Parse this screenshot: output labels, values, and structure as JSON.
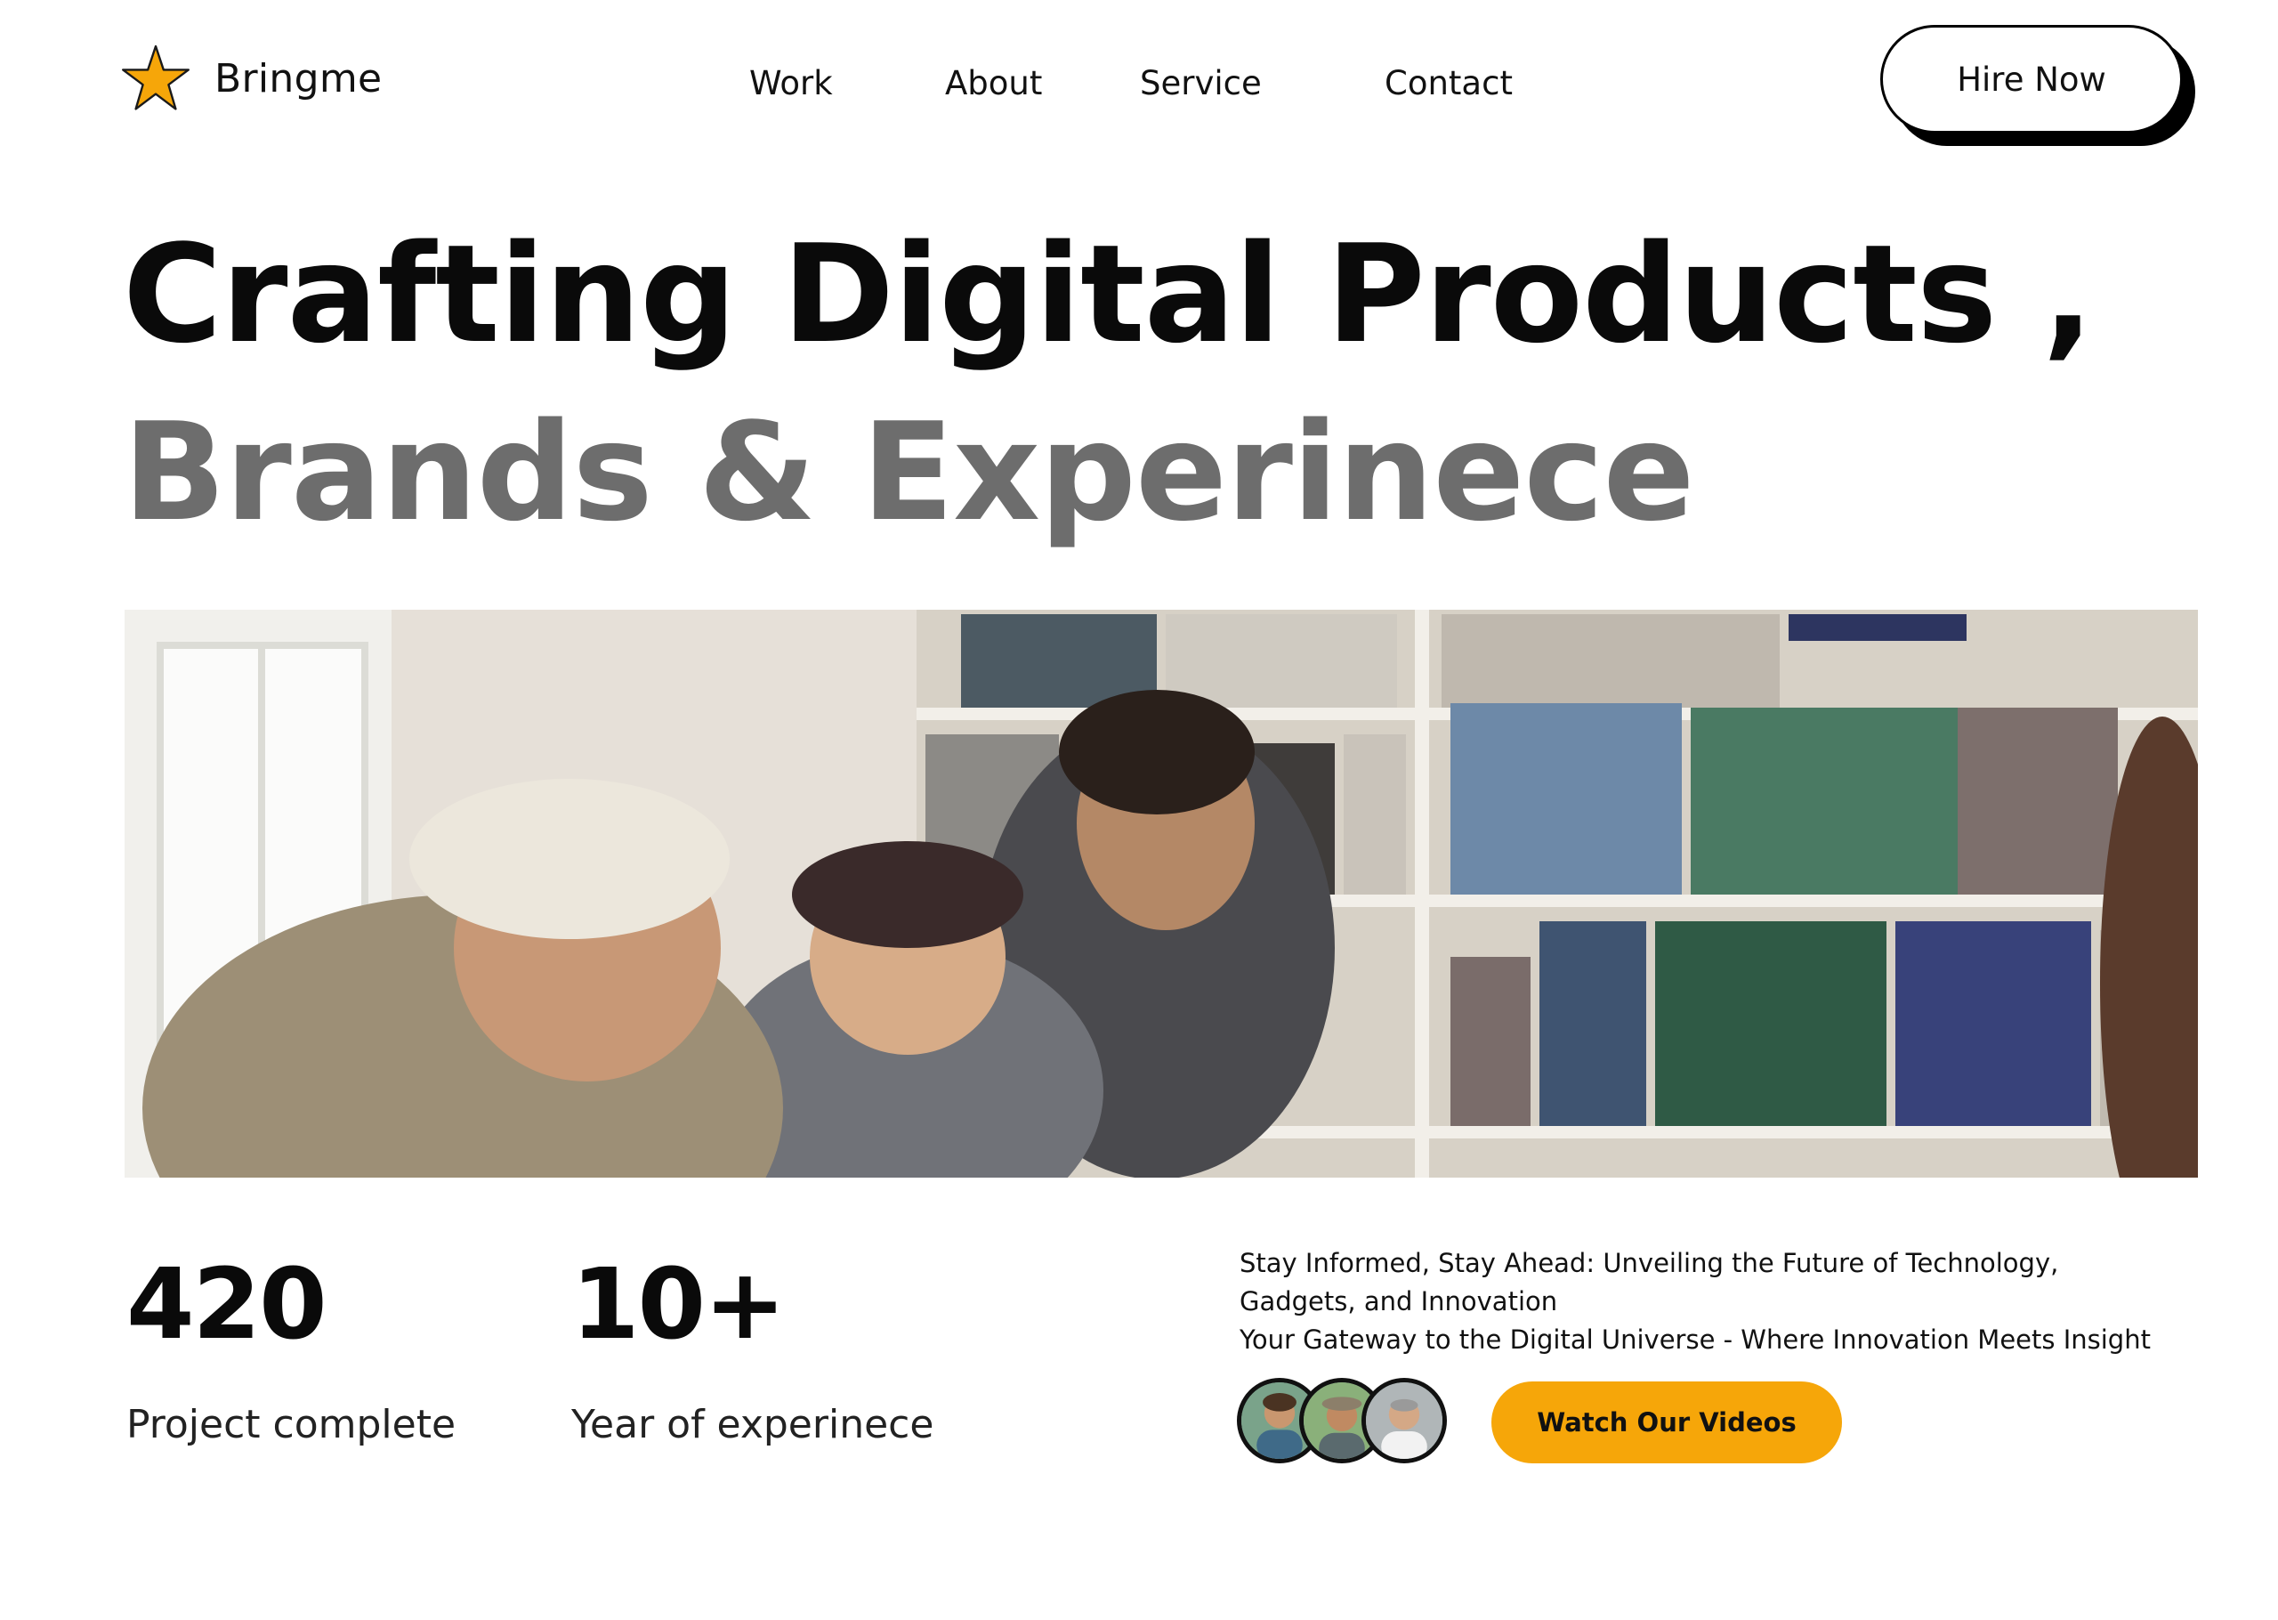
{
  "brand": {
    "name": "Bringme",
    "logo_icon": "star-icon",
    "accent_color": "#f6a609"
  },
  "nav": {
    "items": [
      {
        "label": "Work"
      },
      {
        "label": "About"
      },
      {
        "label": "Service"
      },
      {
        "label": "Contact"
      }
    ],
    "cta_label": "Hire Now"
  },
  "hero": {
    "line1": "Crafting Digital Products ,",
    "line2": "Brands  &  Experinece",
    "line2_color": "#6d6d6d"
  },
  "stats": [
    {
      "value": "420",
      "label": "Project complete"
    },
    {
      "value": "10+",
      "label": "Year of experinece"
    }
  ],
  "info": {
    "tagline_1": "Stay Informed, Stay Ahead: Unveiling the Future of Technology, Gadgets, and Innovation",
    "tagline_2": "Your Gateway to the Digital Universe - Where Innovation Meets Insight",
    "button_label": "Watch Our Videos"
  }
}
